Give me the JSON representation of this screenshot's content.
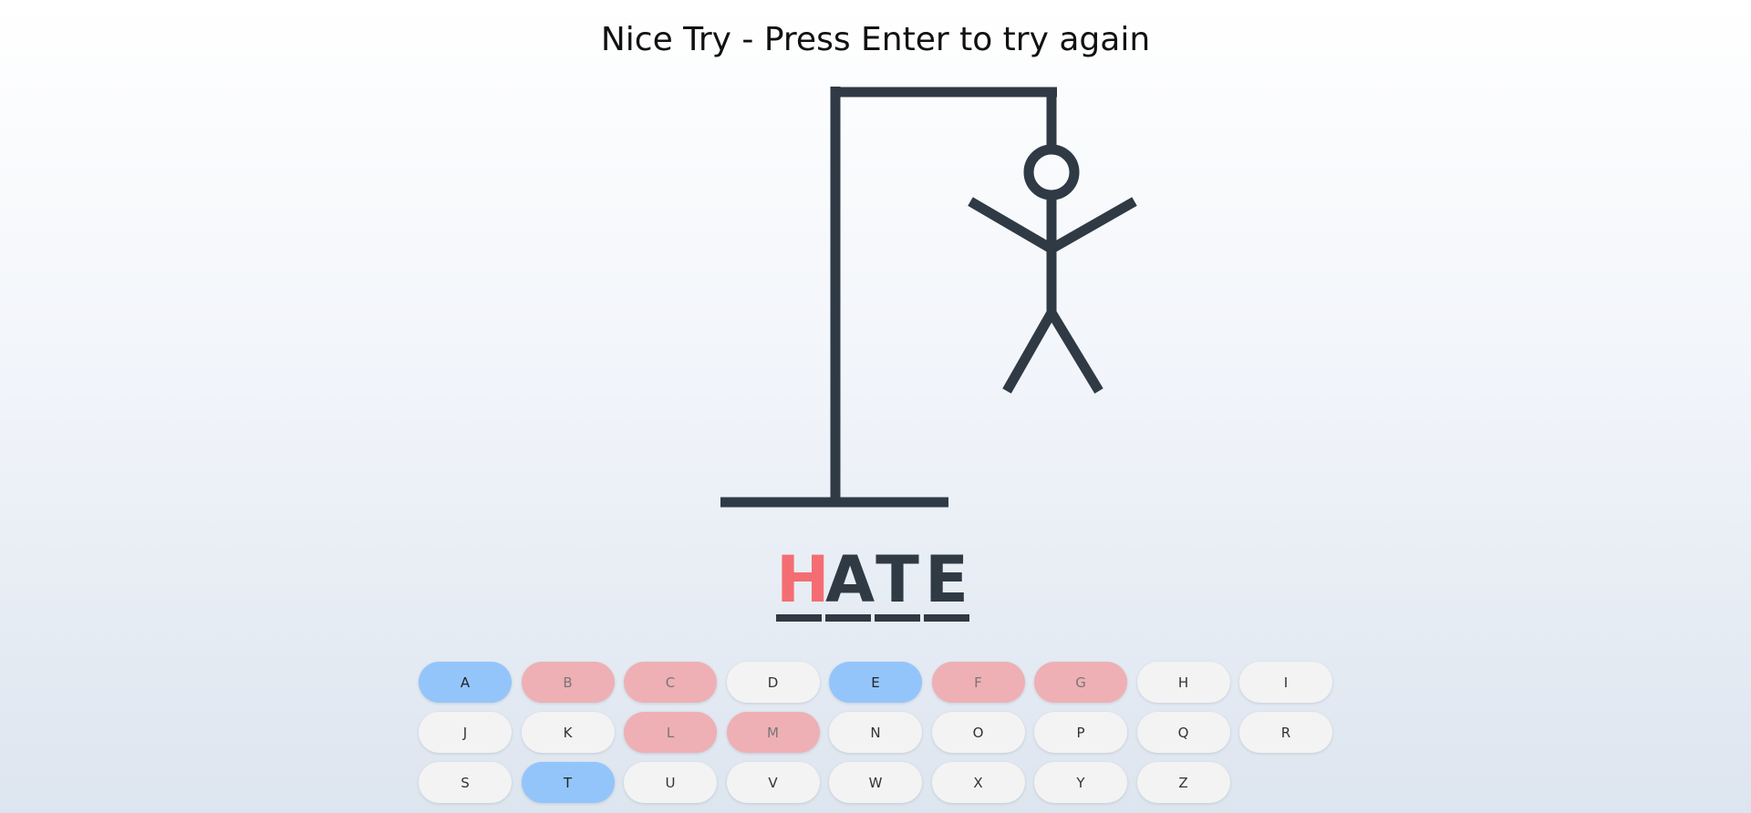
{
  "status_message": "Nice Try - Press Enter to try again",
  "colors": {
    "ink": "#2f3a45",
    "missed_letter": "#f46d72",
    "correct_key": "#93c5fb",
    "wrong_key": "#eeb0b5",
    "unused_key": "#f3f3f3"
  },
  "word": [
    {
      "char": "H",
      "state": "missed"
    },
    {
      "char": "A",
      "state": "guessed"
    },
    {
      "char": "T",
      "state": "guessed"
    },
    {
      "char": "E",
      "state": "guessed"
    }
  ],
  "keyboard": [
    {
      "label": "A",
      "state": "correct"
    },
    {
      "label": "B",
      "state": "wrong"
    },
    {
      "label": "C",
      "state": "wrong"
    },
    {
      "label": "D",
      "state": "unused"
    },
    {
      "label": "E",
      "state": "correct"
    },
    {
      "label": "F",
      "state": "wrong"
    },
    {
      "label": "G",
      "state": "wrong"
    },
    {
      "label": "H",
      "state": "unused"
    },
    {
      "label": "I",
      "state": "unused"
    },
    {
      "label": "J",
      "state": "unused"
    },
    {
      "label": "K",
      "state": "unused"
    },
    {
      "label": "L",
      "state": "wrong"
    },
    {
      "label": "M",
      "state": "wrong"
    },
    {
      "label": "N",
      "state": "unused"
    },
    {
      "label": "O",
      "state": "unused"
    },
    {
      "label": "P",
      "state": "unused"
    },
    {
      "label": "Q",
      "state": "unused"
    },
    {
      "label": "R",
      "state": "unused"
    },
    {
      "label": "S",
      "state": "unused"
    },
    {
      "label": "T",
      "state": "correct"
    },
    {
      "label": "U",
      "state": "unused"
    },
    {
      "label": "V",
      "state": "unused"
    },
    {
      "label": "W",
      "state": "unused"
    },
    {
      "label": "X",
      "state": "unused"
    },
    {
      "label": "Y",
      "state": "unused"
    },
    {
      "label": "Z",
      "state": "unused"
    }
  ]
}
